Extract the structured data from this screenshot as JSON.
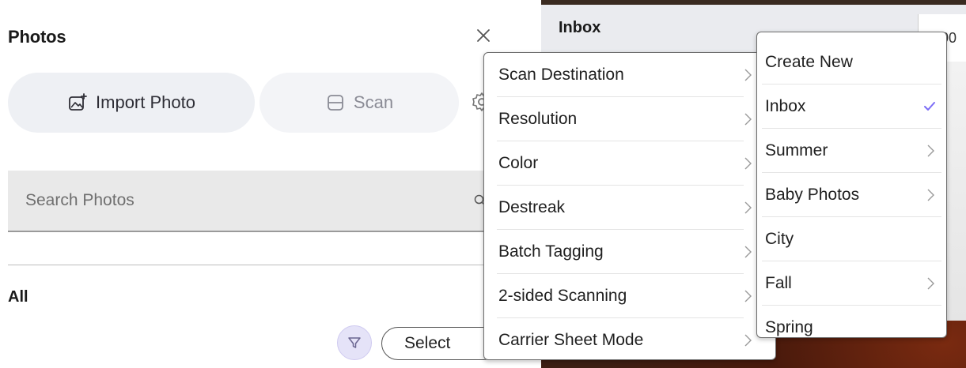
{
  "panel": {
    "title": "Photos",
    "import_label": "Import Photo",
    "scan_label": "Scan",
    "search_placeholder": "Search Photos",
    "all_label": "All",
    "select_label": "Select"
  },
  "inbox": {
    "title": "Inbox",
    "field_text": "00"
  },
  "scan_menu": {
    "items": [
      {
        "label": "Scan Destination"
      },
      {
        "label": "Resolution"
      },
      {
        "label": "Color"
      },
      {
        "label": "Destreak"
      },
      {
        "label": "Batch Tagging"
      },
      {
        "label": "2-sided Scanning"
      },
      {
        "label": "Carrier Sheet Mode"
      }
    ]
  },
  "destination_menu": {
    "items": [
      {
        "label": "Create New",
        "has_submenu": false,
        "checked": false
      },
      {
        "label": "Inbox",
        "has_submenu": false,
        "checked": true
      },
      {
        "label": "Summer",
        "has_submenu": true,
        "checked": false
      },
      {
        "label": "Baby Photos",
        "has_submenu": true,
        "checked": false
      },
      {
        "label": "City",
        "has_submenu": false,
        "checked": false
      },
      {
        "label": "Fall",
        "has_submenu": true,
        "checked": false
      },
      {
        "label": "Spring",
        "has_submenu": false,
        "checked": false
      }
    ]
  },
  "colors": {
    "accent": "#7b6cf6",
    "pill_bg": "#eef0f4",
    "search_bg": "#e9e9e9"
  },
  "icons": [
    "close-icon",
    "import-photo-icon",
    "scan-icon",
    "gear-icon",
    "search-icon",
    "filter-icon",
    "chevron-right-icon",
    "checkmark-icon"
  ]
}
